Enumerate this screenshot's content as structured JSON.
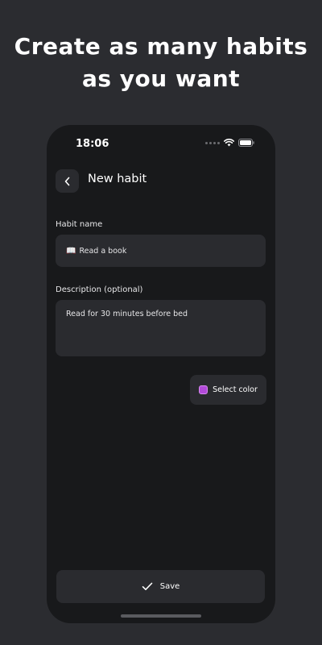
{
  "headline": {
    "line1": "Create as many habits",
    "line2": "as you want"
  },
  "status_bar": {
    "time": "18:06"
  },
  "nav": {
    "title": "New habit"
  },
  "form": {
    "habit_name_label": "Habit name",
    "habit_name_emoji": "📖",
    "habit_name_value": "Read a book",
    "description_label": "Description (optional)",
    "description_value": "Read for 30 minutes before bed"
  },
  "color_button": {
    "label": "Select color",
    "selected_color": "#b24ad9"
  },
  "save_button": {
    "label": "Save"
  },
  "colors": {
    "page_background": "#2b2c30",
    "screen_background": "#18191b",
    "field_background": "#2a2b2f"
  }
}
